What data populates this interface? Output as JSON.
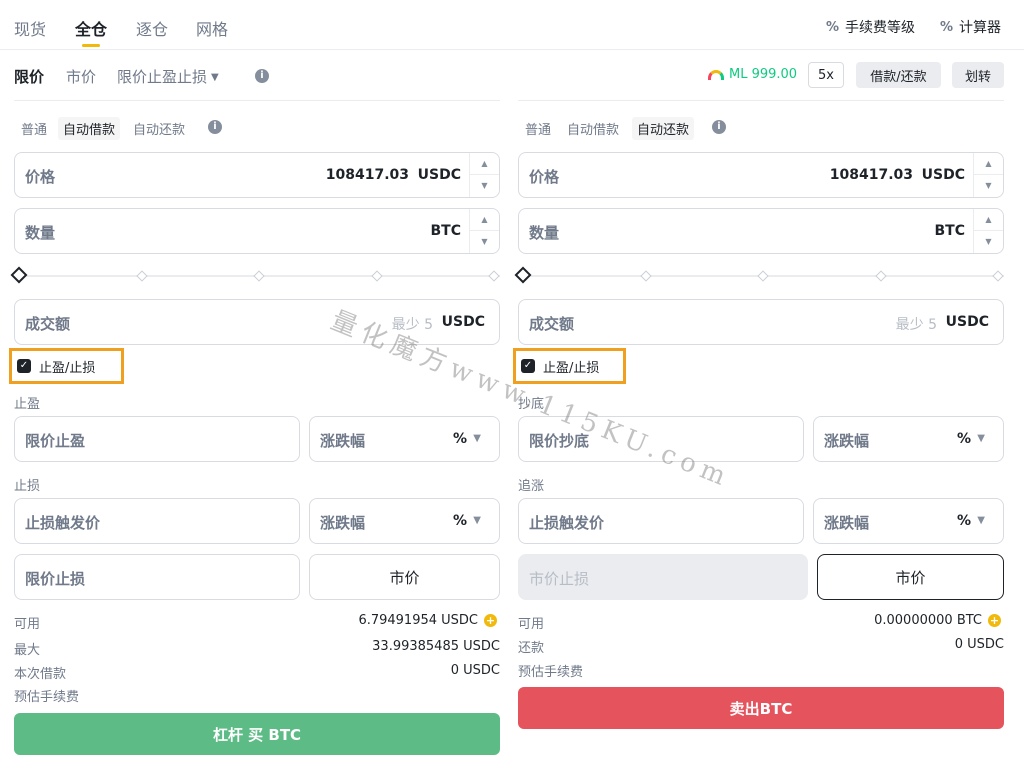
{
  "tabs": [
    "现货",
    "全仓",
    "逐仓",
    "网格"
  ],
  "tools": {
    "fee_level": "手续费等级",
    "calculator": "计算器",
    "fee_icon": "percent-icon",
    "calc_icon": "calculator-icon"
  },
  "order_types": {
    "limit": "限价",
    "market": "市价",
    "tpsl": "限价止盈止损"
  },
  "account": {
    "ml_label": "ML 999.00",
    "leverage": "5x",
    "borrow_repay": "借款/还款",
    "transfer": "划转"
  },
  "buy_panel": {
    "modes": [
      "普通",
      "自动借款",
      "自动还款"
    ],
    "price_label": "价格",
    "price_value": "108417.03",
    "price_unit": "USDC",
    "qty_label": "数量",
    "qty_unit": "BTC",
    "total_label": "成交额",
    "total_hint": "最少 5",
    "total_unit": "USDC",
    "tpsl_checkbox": "止盈/止损",
    "tp_section": "止盈",
    "tp_price": "限价止盈",
    "tp_pct": "涨跌幅",
    "tp_pct_unit": "%",
    "sl_section": "止损",
    "sl_trigger": "止损触发价",
    "sl_pct": "涨跌幅",
    "sl_pct_unit": "%",
    "sl_limit": "限价止损",
    "sl_market": "市价",
    "available_label": "可用",
    "available_value": "6.79491954 USDC",
    "max_label": "最大",
    "max_value": "33.99385485 USDC",
    "borrow_label": "本次借款",
    "borrow_value": "0 USDC",
    "fee_label": "预估手续费",
    "action": "杠杆 买 BTC"
  },
  "sell_panel": {
    "modes": [
      "普通",
      "自动借款",
      "自动还款"
    ],
    "price_label": "价格",
    "price_value": "108417.03",
    "price_unit": "USDC",
    "qty_label": "数量",
    "qty_unit": "BTC",
    "total_label": "成交额",
    "total_hint": "最少 5",
    "total_unit": "USDC",
    "tpsl_checkbox": "止盈/止损",
    "tp_section": "抄底",
    "tp_price": "限价抄底",
    "tp_pct": "涨跌幅",
    "tp_pct_unit": "%",
    "sl_section": "追涨",
    "sl_trigger": "止损触发价",
    "sl_pct": "涨跌幅",
    "sl_pct_unit": "%",
    "sl_limit": "市价止损",
    "sl_market": "市价",
    "available_label": "可用",
    "available_value": "0.00000000 BTC",
    "repay_label": "还款",
    "repay_value": "0 USDC",
    "fee_label": "预估手续费",
    "action": "卖出BTC"
  },
  "watermark": "量化魔方www.115KU.com",
  "colors": {
    "accent": "#f0b90b",
    "buy": "#5dbb86",
    "sell": "#e5535d",
    "highlight": "#f0a020",
    "ml": "#0ecb81"
  }
}
